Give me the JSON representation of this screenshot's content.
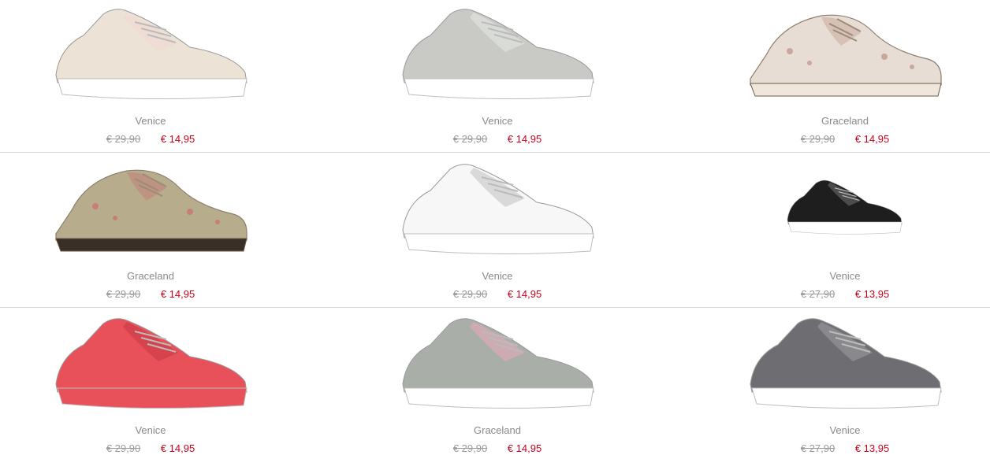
{
  "products": [
    {
      "brand": "Venice",
      "old_price": "€ 29,90",
      "new_price": "€ 14,95",
      "icon": "sneaker-icon",
      "color": "#ece3d6",
      "accent": "#f2d8d3",
      "sole": "#ffffff",
      "style": "sneaker"
    },
    {
      "brand": "Venice",
      "old_price": "€ 29,90",
      "new_price": "€ 14,95",
      "icon": "sneaker-icon",
      "color": "#c9cac6",
      "accent": "#e5e6e3",
      "sole": "#ffffff",
      "style": "sneaker"
    },
    {
      "brand": "Graceland",
      "old_price": "€ 29,90",
      "new_price": "€ 14,95",
      "icon": "lace-up-shoe-icon",
      "color": "#e8ddd5",
      "accent": "#c8a89a",
      "sole": "#efe6dc",
      "style": "oxford"
    },
    {
      "brand": "Graceland",
      "old_price": "€ 29,90",
      "new_price": "€ 14,95",
      "icon": "brogue-shoe-icon",
      "color": "#b7ad8d",
      "accent": "#c77e7a",
      "sole": "#3a2f26",
      "style": "oxford"
    },
    {
      "brand": "Venice",
      "old_price": "€ 29,90",
      "new_price": "€ 14,95",
      "icon": "sneaker-icon",
      "color": "#f7f7f7",
      "accent": "#c4c4c4",
      "sole": "#ffffff",
      "style": "sneaker"
    },
    {
      "brand": "Venice",
      "old_price": "€ 27,90",
      "new_price": "€ 13,95",
      "icon": "sneaker-icon",
      "color": "#1e1e1e",
      "accent": "#6b6b6b",
      "sole": "#ffffff",
      "style": "small"
    },
    {
      "brand": "Venice",
      "old_price": "€ 29,90",
      "new_price": "€ 14,95",
      "icon": "sneaker-icon",
      "color": "#e8505a",
      "accent": "#c93a44",
      "sole": "#e8505a",
      "style": "sneaker"
    },
    {
      "brand": "Graceland",
      "old_price": "€ 29,90",
      "new_price": "€ 14,95",
      "icon": "sneaker-icon",
      "color": "#a9aea8",
      "accent": "#e8a7bb",
      "sole": "#ffffff",
      "style": "sneaker"
    },
    {
      "brand": "Venice",
      "old_price": "€ 27,90",
      "new_price": "€ 13,95",
      "icon": "sneaker-icon",
      "color": "#6e6e72",
      "accent": "#9a9aa0",
      "sole": "#ffffff",
      "style": "sneaker"
    }
  ]
}
